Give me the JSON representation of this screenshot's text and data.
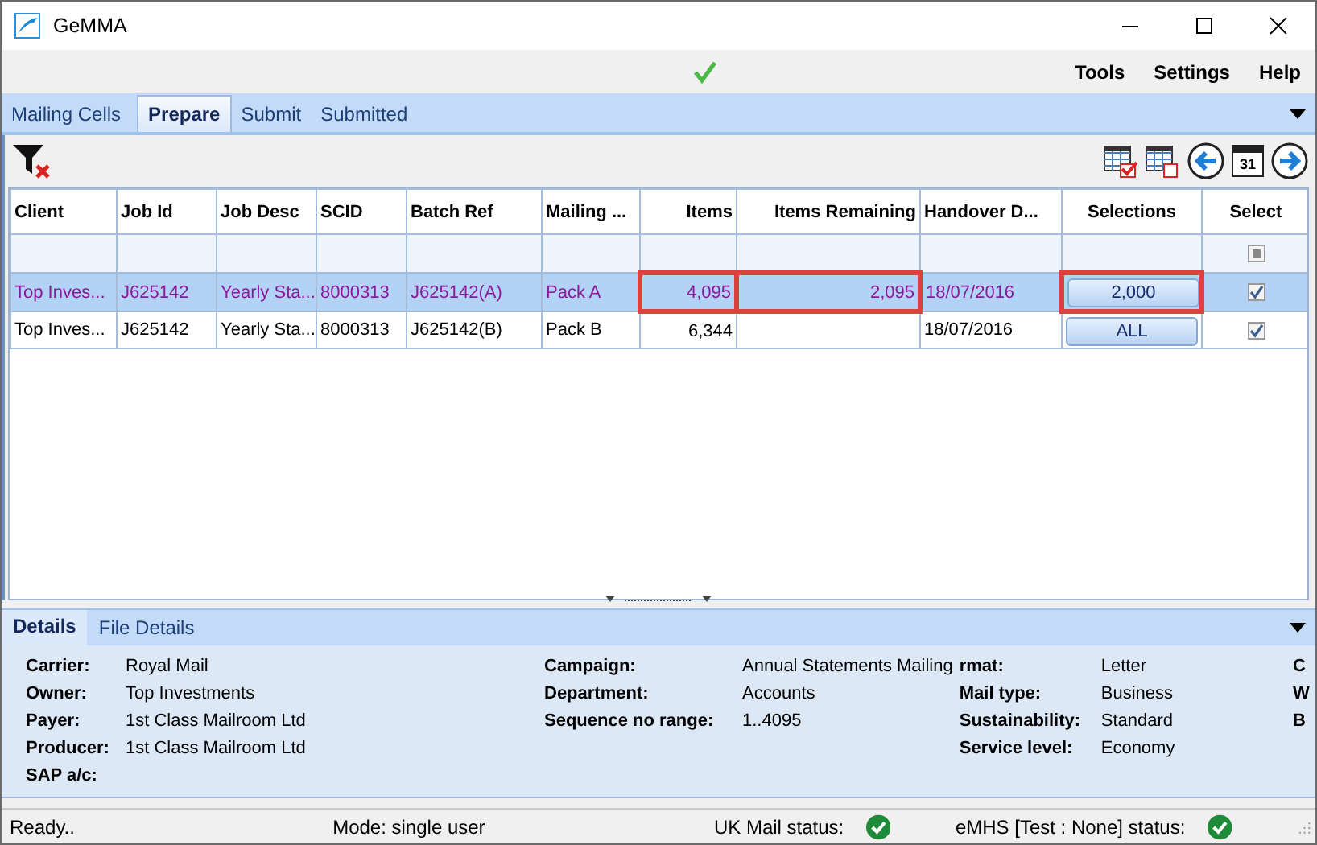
{
  "window": {
    "title": "GeMMA"
  },
  "menu": {
    "connection_ok": true,
    "items": [
      "Tools",
      "Settings",
      "Help"
    ]
  },
  "tabs": [
    {
      "label": "Mailing Cells",
      "selected": false
    },
    {
      "label": "Prepare",
      "selected": true
    },
    {
      "label": "Submit",
      "selected": false
    },
    {
      "label": "Submitted",
      "selected": false
    }
  ],
  "toolbar": {
    "calendar_day": "31"
  },
  "table": {
    "columns": [
      {
        "label": "Client",
        "kind": "text"
      },
      {
        "label": "Job Id",
        "kind": "text"
      },
      {
        "label": "Job Desc",
        "kind": "text"
      },
      {
        "label": "SCID",
        "kind": "text"
      },
      {
        "label": "Batch Ref",
        "kind": "text"
      },
      {
        "label": "Mailing ...",
        "kind": "text"
      },
      {
        "label": "Items",
        "kind": "number"
      },
      {
        "label": "Items Remaining",
        "kind": "number"
      },
      {
        "label": "Handover D...",
        "kind": "text"
      },
      {
        "label": "Selections",
        "kind": "button"
      },
      {
        "label": "Select",
        "kind": "check"
      }
    ],
    "filter_row": {
      "select_all_indeterminate": true
    },
    "rows": [
      {
        "selected": true,
        "cells": [
          {
            "text": "Top Inves...",
            "highlighted": false
          },
          {
            "text": "J625142",
            "highlighted": false
          },
          {
            "text": "Yearly Sta...",
            "highlighted": false
          },
          {
            "text": "8000313",
            "highlighted": false
          },
          {
            "text": "J625142(A)",
            "highlighted": false
          },
          {
            "text": "Pack A",
            "highlighted": false
          },
          {
            "text": "4,095",
            "highlighted": true
          },
          {
            "text": "2,095",
            "highlighted": true
          },
          {
            "text": "18/07/2016",
            "highlighted": false
          },
          {
            "text": "2,000",
            "highlighted": true
          },
          {
            "checked": true,
            "highlighted": false
          }
        ]
      },
      {
        "selected": false,
        "cells": [
          {
            "text": "Top Inves...",
            "highlighted": false
          },
          {
            "text": "J625142",
            "highlighted": false
          },
          {
            "text": "Yearly Sta...",
            "highlighted": false
          },
          {
            "text": "8000313",
            "highlighted": false
          },
          {
            "text": "J625142(B)",
            "highlighted": false
          },
          {
            "text": "Pack B",
            "highlighted": false
          },
          {
            "text": "6,344",
            "highlighted": false
          },
          {
            "highlighted": false
          },
          {
            "text": "18/07/2016",
            "highlighted": false
          },
          {
            "text": "ALL",
            "highlighted": false
          },
          {
            "checked": true,
            "highlighted": false
          }
        ]
      }
    ]
  },
  "details": {
    "tabs": [
      {
        "label": "Details",
        "selected": true
      },
      {
        "label": "File Details",
        "selected": false
      }
    ],
    "columns": [
      [
        {
          "label": "Carrier:",
          "value": "Royal Mail"
        },
        {
          "label": "Owner:",
          "value": "Top Investments"
        },
        {
          "label": "Payer:",
          "value": "1st Class Mailroom Ltd"
        },
        {
          "label": "Producer:",
          "value": "1st Class Mailroom Ltd"
        },
        {
          "label": "SAP a/c:"
        }
      ],
      [
        {
          "label": "Campaign:",
          "value": "Annual Statements Mailing"
        },
        {
          "label": "Department:",
          "value": "Accounts"
        },
        {
          "label": "Sequence no range:",
          "value": "1..4095"
        }
      ],
      [
        {
          "label": "rmat:",
          "value": "Letter"
        },
        {
          "label": "Mail type:",
          "value": "Business"
        },
        {
          "label": "Sustainability:",
          "value": "Standard"
        },
        {
          "label": "Service level:",
          "value": "Economy"
        }
      ],
      [
        {
          "label": "C"
        },
        {
          "label": "W"
        },
        {
          "label": "B"
        }
      ]
    ]
  },
  "status_bar": {
    "message": "Ready..",
    "mode": "Mode: single user",
    "services": [
      {
        "label": "UK Mail status:",
        "ok": true
      },
      {
        "label": "eMHS [Test : None] status:",
        "ok": true
      }
    ]
  }
}
